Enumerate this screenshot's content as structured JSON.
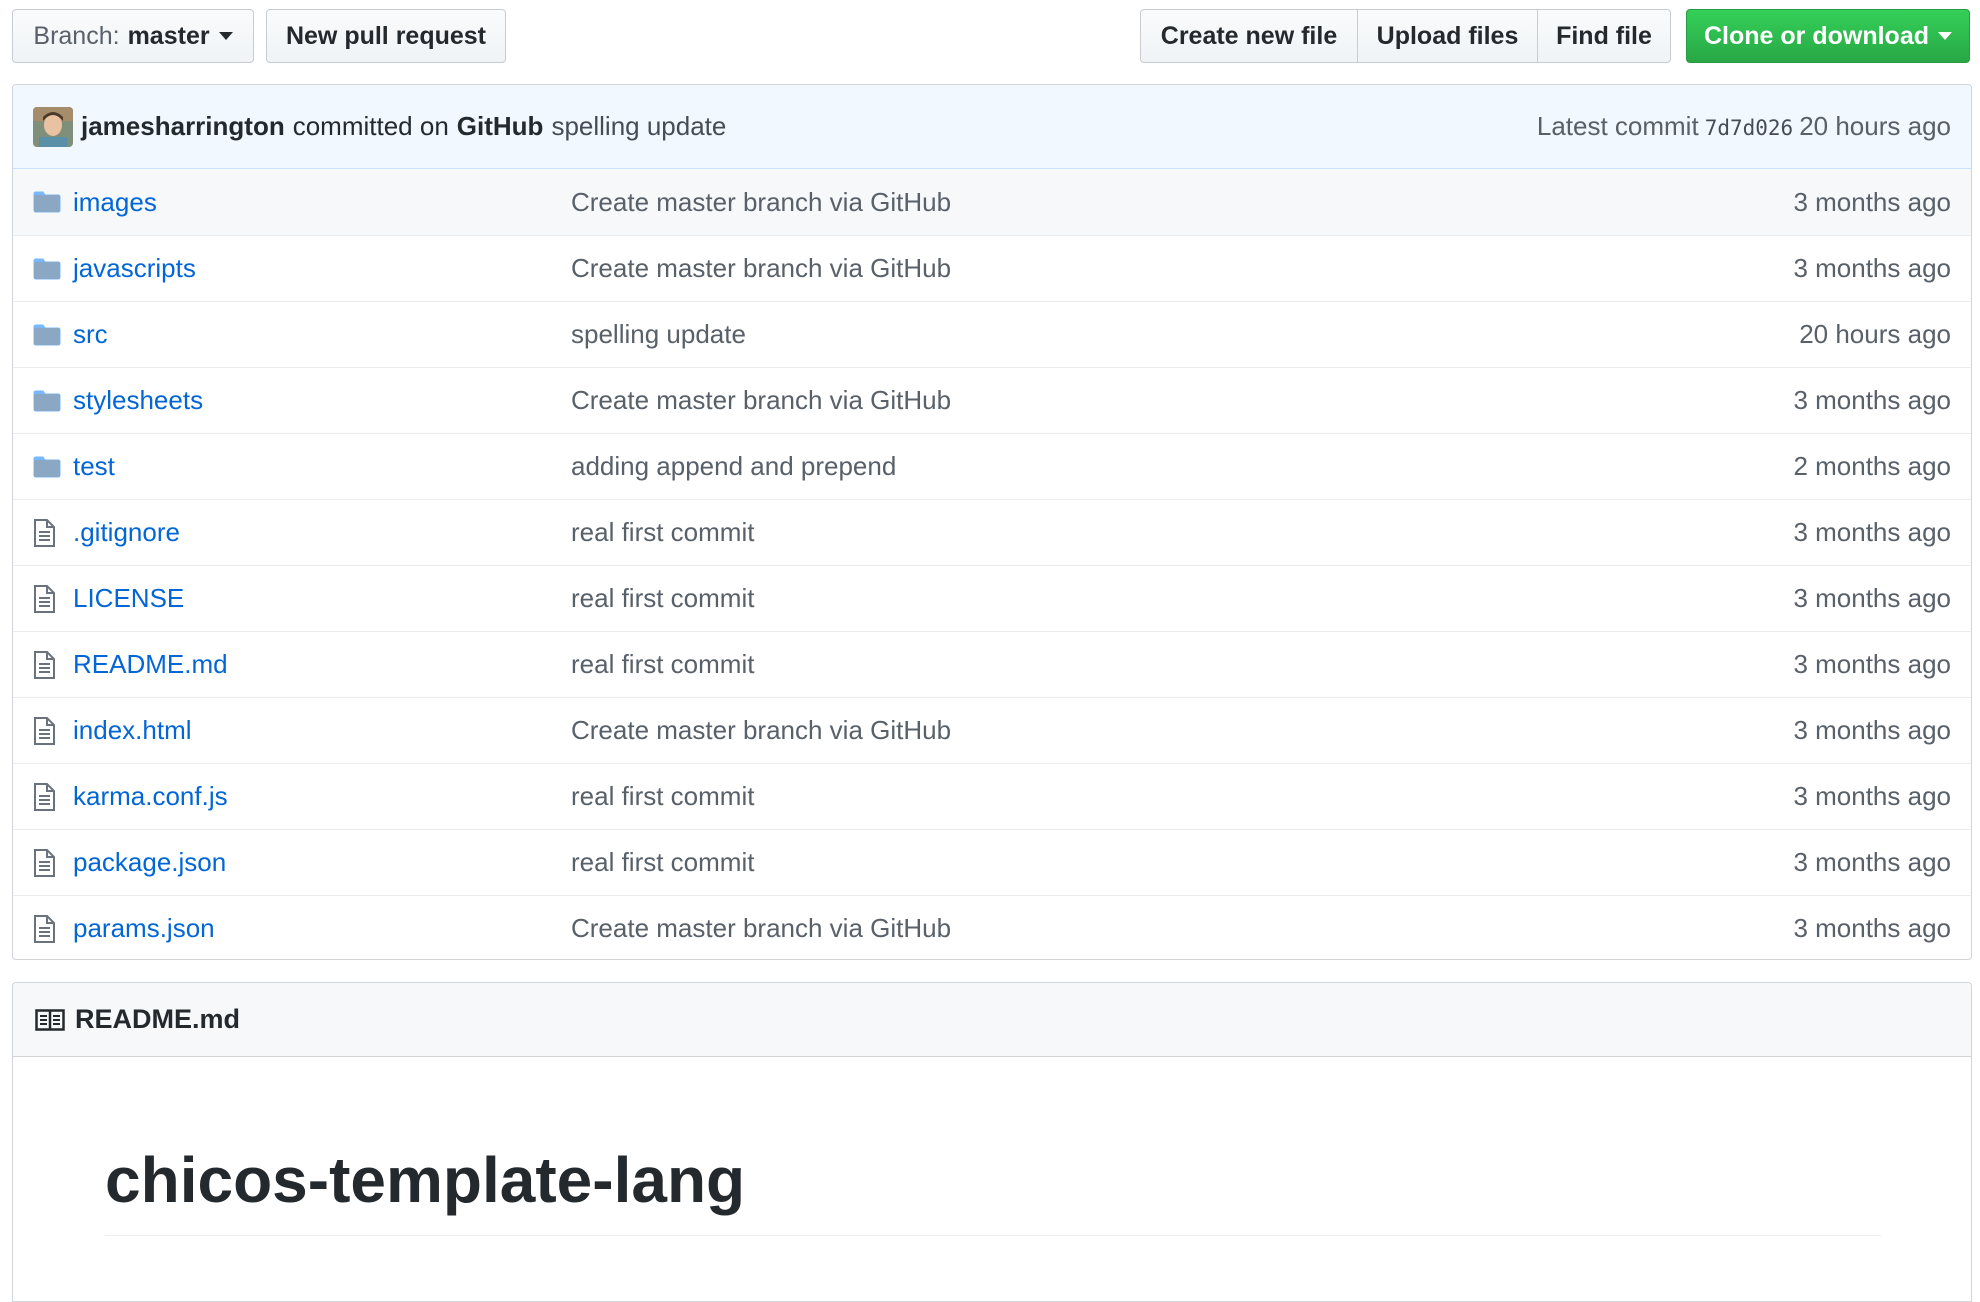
{
  "toolbar": {
    "branch_prefix": "Branch:",
    "branch_name": "master",
    "new_pull_request": "New pull request",
    "create_new_file": "Create new file",
    "upload_files": "Upload files",
    "find_file": "Find file",
    "clone_or_download": "Clone or download"
  },
  "commit": {
    "author": "jamesharrington",
    "committed_on": "committed on",
    "platform": "GitHub",
    "message": "spelling update",
    "latest_label": "Latest commit",
    "sha": "7d7d026",
    "age": "20 hours ago"
  },
  "files": [
    {
      "name": "images",
      "type": "folder",
      "message": "Create master branch via GitHub",
      "age": "3 months ago"
    },
    {
      "name": "javascripts",
      "type": "folder",
      "message": "Create master branch via GitHub",
      "age": "3 months ago"
    },
    {
      "name": "src",
      "type": "folder",
      "message": "spelling update",
      "age": "20 hours ago"
    },
    {
      "name": "stylesheets",
      "type": "folder",
      "message": "Create master branch via GitHub",
      "age": "3 months ago"
    },
    {
      "name": "test",
      "type": "folder",
      "message": "adding append and prepend",
      "age": "2 months ago"
    },
    {
      "name": ".gitignore",
      "type": "file",
      "message": "real first commit",
      "age": "3 months ago"
    },
    {
      "name": "LICENSE",
      "type": "file",
      "message": "real first commit",
      "age": "3 months ago"
    },
    {
      "name": "README.md",
      "type": "file",
      "message": "real first commit",
      "age": "3 months ago"
    },
    {
      "name": "index.html",
      "type": "file",
      "message": "Create master branch via GitHub",
      "age": "3 months ago"
    },
    {
      "name": "karma.conf.js",
      "type": "file",
      "message": "real first commit",
      "age": "3 months ago"
    },
    {
      "name": "package.json",
      "type": "file",
      "message": "real first commit",
      "age": "3 months ago"
    },
    {
      "name": "params.json",
      "type": "file",
      "message": "Create master branch via GitHub",
      "age": "3 months ago"
    }
  ],
  "readme": {
    "filename": "README.md",
    "heading": "chicos-template-lang"
  },
  "colors": {
    "link": "#0366d6",
    "accent_green": "#28a745",
    "commit_bar": "#f1f8ff"
  }
}
